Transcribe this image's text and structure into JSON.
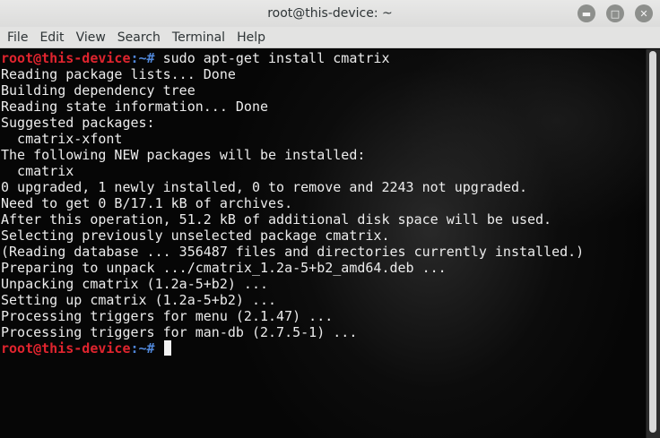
{
  "window": {
    "title": "root@this-device: ~",
    "controls": {
      "minimize": "minimize-icon",
      "maximize": "maximize-icon",
      "close": "close-icon"
    }
  },
  "menu": [
    "File",
    "Edit",
    "View",
    "Search",
    "Terminal",
    "Help"
  ],
  "terminal": {
    "prompt": {
      "user": "root@this-device",
      "path": ":~#",
      "command": " sudo apt-get install cmatrix"
    },
    "output": [
      "Reading package lists... Done",
      "Building dependency tree",
      "Reading state information... Done",
      "Suggested packages:",
      "  cmatrix-xfont",
      "The following NEW packages will be installed:",
      "  cmatrix",
      "0 upgraded, 1 newly installed, 0 to remove and 2243 not upgraded.",
      "Need to get 0 B/17.1 kB of archives.",
      "After this operation, 51.2 kB of additional disk space will be used.",
      "Selecting previously unselected package cmatrix.",
      "(Reading database ... 356487 files and directories currently installed.)",
      "Preparing to unpack .../cmatrix_1.2a-5+b2_amd64.deb ...",
      "Unpacking cmatrix (1.2a-5+b2) ...",
      "Setting up cmatrix (1.2a-5+b2) ...",
      "Processing triggers for menu (2.1.47) ...",
      "Processing triggers for man-db (2.7.5-1) ..."
    ],
    "final_prompt": {
      "user": "root@this-device",
      "path": ":~#",
      "command": " "
    }
  },
  "colors": {
    "prompt_user": "#e0242e",
    "prompt_path": "#4f86d8",
    "text": "#ececec"
  }
}
